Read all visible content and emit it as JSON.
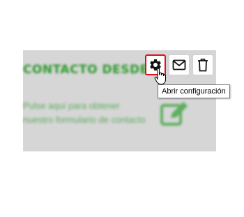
{
  "widget": {
    "title": "CONTACTO DESDE",
    "description": "Pulse aquí para obtener nuestro formulario de contacto",
    "accent_color": "#2f9a2f",
    "edit_icon": "edit-icon"
  },
  "toolbar": {
    "settings_icon": "gear-icon",
    "mail_icon": "envelope-icon",
    "delete_icon": "trash-icon",
    "highlight_color": "#e0101a"
  },
  "tooltip": {
    "text": "Abrir configuración"
  }
}
